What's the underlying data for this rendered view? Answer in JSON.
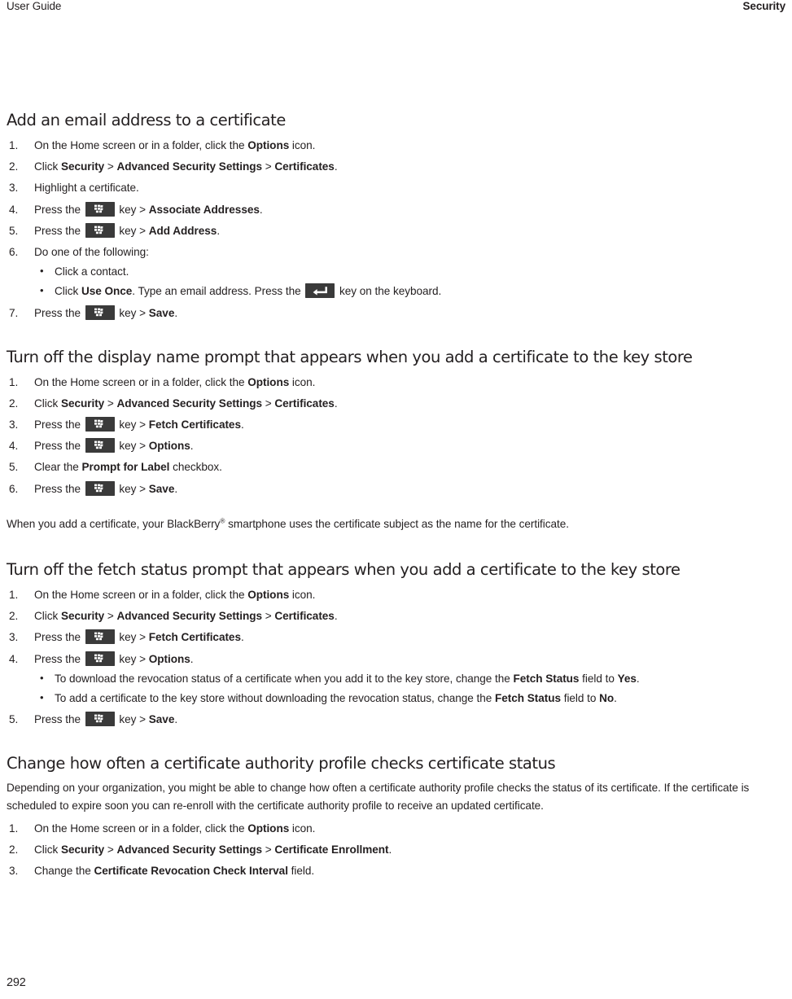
{
  "header": {
    "left": "User Guide",
    "right": "Security"
  },
  "footer": {
    "page_number": "292"
  },
  "icons": {
    "menu_key": "blackberry-menu-key-icon",
    "enter_key": "enter-key-icon"
  },
  "sections": [
    {
      "heading": "Add an email address to a certificate",
      "steps": [
        {
          "parts": [
            {
              "t": "text",
              "v": "On the Home screen or in a folder, click the "
            },
            {
              "t": "bold",
              "v": "Options"
            },
            {
              "t": "text",
              "v": " icon."
            }
          ]
        },
        {
          "parts": [
            {
              "t": "text",
              "v": "Click "
            },
            {
              "t": "bold",
              "v": "Security"
            },
            {
              "t": "text",
              "v": " > "
            },
            {
              "t": "bold",
              "v": "Advanced Security Settings"
            },
            {
              "t": "text",
              "v": " > "
            },
            {
              "t": "bold",
              "v": "Certificates"
            },
            {
              "t": "text",
              "v": "."
            }
          ]
        },
        {
          "parts": [
            {
              "t": "text",
              "v": "Highlight a certificate."
            }
          ]
        },
        {
          "parts": [
            {
              "t": "text",
              "v": "Press the "
            },
            {
              "t": "menukey"
            },
            {
              "t": "text",
              "v": " key > "
            },
            {
              "t": "bold",
              "v": "Associate Addresses"
            },
            {
              "t": "text",
              "v": "."
            }
          ]
        },
        {
          "parts": [
            {
              "t": "text",
              "v": "Press the "
            },
            {
              "t": "menukey"
            },
            {
              "t": "text",
              "v": " key > "
            },
            {
              "t": "bold",
              "v": "Add Address"
            },
            {
              "t": "text",
              "v": "."
            }
          ]
        },
        {
          "parts": [
            {
              "t": "text",
              "v": "Do one of the following:"
            }
          ],
          "substeps": [
            {
              "parts": [
                {
                  "t": "text",
                  "v": "Click a contact."
                }
              ]
            },
            {
              "parts": [
                {
                  "t": "text",
                  "v": "Click "
                },
                {
                  "t": "bold",
                  "v": "Use Once"
                },
                {
                  "t": "text",
                  "v": ". Type an email address. Press the "
                },
                {
                  "t": "enterkey"
                },
                {
                  "t": "text",
                  "v": " key on the keyboard."
                }
              ]
            }
          ]
        },
        {
          "parts": [
            {
              "t": "text",
              "v": "Press the "
            },
            {
              "t": "menukey"
            },
            {
              "t": "text",
              "v": " key > "
            },
            {
              "t": "bold",
              "v": "Save"
            },
            {
              "t": "text",
              "v": "."
            }
          ]
        }
      ]
    },
    {
      "heading": "Turn off the display name prompt that appears when you add a certificate to the key store",
      "steps": [
        {
          "parts": [
            {
              "t": "text",
              "v": "On the Home screen or in a folder, click the "
            },
            {
              "t": "bold",
              "v": "Options"
            },
            {
              "t": "text",
              "v": " icon."
            }
          ]
        },
        {
          "parts": [
            {
              "t": "text",
              "v": "Click "
            },
            {
              "t": "bold",
              "v": "Security"
            },
            {
              "t": "text",
              "v": " > "
            },
            {
              "t": "bold",
              "v": "Advanced Security Settings"
            },
            {
              "t": "text",
              "v": " > "
            },
            {
              "t": "bold",
              "v": "Certificates"
            },
            {
              "t": "text",
              "v": "."
            }
          ]
        },
        {
          "parts": [
            {
              "t": "text",
              "v": "Press the "
            },
            {
              "t": "menukey"
            },
            {
              "t": "text",
              "v": " key > "
            },
            {
              "t": "bold",
              "v": "Fetch Certificates"
            },
            {
              "t": "text",
              "v": "."
            }
          ]
        },
        {
          "parts": [
            {
              "t": "text",
              "v": "Press the "
            },
            {
              "t": "menukey"
            },
            {
              "t": "text",
              "v": " key > "
            },
            {
              "t": "bold",
              "v": "Options"
            },
            {
              "t": "text",
              "v": "."
            }
          ]
        },
        {
          "parts": [
            {
              "t": "text",
              "v": "Clear the "
            },
            {
              "t": "bold",
              "v": "Prompt for Label"
            },
            {
              "t": "text",
              "v": " checkbox."
            }
          ]
        },
        {
          "parts": [
            {
              "t": "text",
              "v": "Press the "
            },
            {
              "t": "menukey"
            },
            {
              "t": "text",
              "v": " key > "
            },
            {
              "t": "bold",
              "v": "Save"
            },
            {
              "t": "text",
              "v": "."
            }
          ]
        }
      ],
      "after_paragraph": [
        {
          "t": "text",
          "v": "When you add a certificate, your BlackBerry"
        },
        {
          "t": "sup",
          "v": "®"
        },
        {
          "t": "text",
          "v": " smartphone uses the certificate subject as the name for the certificate."
        }
      ]
    },
    {
      "heading": "Turn off the fetch status prompt that appears when you add a certificate to the key store",
      "steps": [
        {
          "parts": [
            {
              "t": "text",
              "v": "On the Home screen or in a folder, click the "
            },
            {
              "t": "bold",
              "v": "Options"
            },
            {
              "t": "text",
              "v": " icon."
            }
          ]
        },
        {
          "parts": [
            {
              "t": "text",
              "v": "Click "
            },
            {
              "t": "bold",
              "v": "Security"
            },
            {
              "t": "text",
              "v": " > "
            },
            {
              "t": "bold",
              "v": "Advanced Security Settings"
            },
            {
              "t": "text",
              "v": " > "
            },
            {
              "t": "bold",
              "v": "Certificates"
            },
            {
              "t": "text",
              "v": "."
            }
          ]
        },
        {
          "parts": [
            {
              "t": "text",
              "v": "Press the "
            },
            {
              "t": "menukey"
            },
            {
              "t": "text",
              "v": " key > "
            },
            {
              "t": "bold",
              "v": "Fetch Certificates"
            },
            {
              "t": "text",
              "v": "."
            }
          ]
        },
        {
          "parts": [
            {
              "t": "text",
              "v": "Press the "
            },
            {
              "t": "menukey"
            },
            {
              "t": "text",
              "v": " key > "
            },
            {
              "t": "bold",
              "v": "Options"
            },
            {
              "t": "text",
              "v": "."
            }
          ],
          "substeps": [
            {
              "parts": [
                {
                  "t": "text",
                  "v": "To download the revocation status of a certificate when you add it to the key store, change the "
                },
                {
                  "t": "bold",
                  "v": "Fetch Status"
                },
                {
                  "t": "text",
                  "v": " field to "
                },
                {
                  "t": "bold",
                  "v": "Yes"
                },
                {
                  "t": "text",
                  "v": "."
                }
              ]
            },
            {
              "parts": [
                {
                  "t": "text",
                  "v": "To add a certificate to the key store without downloading the revocation status, change the "
                },
                {
                  "t": "bold",
                  "v": "Fetch Status"
                },
                {
                  "t": "text",
                  "v": " field to "
                },
                {
                  "t": "bold",
                  "v": "No"
                },
                {
                  "t": "text",
                  "v": "."
                }
              ]
            }
          ]
        },
        {
          "parts": [
            {
              "t": "text",
              "v": "Press the "
            },
            {
              "t": "menukey"
            },
            {
              "t": "text",
              "v": " key > "
            },
            {
              "t": "bold",
              "v": "Save"
            },
            {
              "t": "text",
              "v": "."
            }
          ]
        }
      ]
    },
    {
      "heading": "Change how often a certificate authority profile checks certificate status",
      "intro_paragraph": [
        {
          "t": "text",
          "v": "Depending on your organization, you might be able to change how often a certificate authority profile checks the status of its certificate. If the certificate is scheduled to expire soon you can re-enroll with the certificate authority profile to receive an updated certificate."
        }
      ],
      "steps": [
        {
          "parts": [
            {
              "t": "text",
              "v": "On the Home screen or in a folder, click the "
            },
            {
              "t": "bold",
              "v": "Options"
            },
            {
              "t": "text",
              "v": " icon."
            }
          ]
        },
        {
          "parts": [
            {
              "t": "text",
              "v": "Click "
            },
            {
              "t": "bold",
              "v": "Security"
            },
            {
              "t": "text",
              "v": " > "
            },
            {
              "t": "bold",
              "v": "Advanced Security Settings"
            },
            {
              "t": "text",
              "v": " > "
            },
            {
              "t": "bold",
              "v": "Certificate Enrollment"
            },
            {
              "t": "text",
              "v": "."
            }
          ]
        },
        {
          "parts": [
            {
              "t": "text",
              "v": "Change the "
            },
            {
              "t": "bold",
              "v": "Certificate Revocation Check Interval"
            },
            {
              "t": "text",
              "v": " field."
            }
          ]
        }
      ]
    }
  ]
}
